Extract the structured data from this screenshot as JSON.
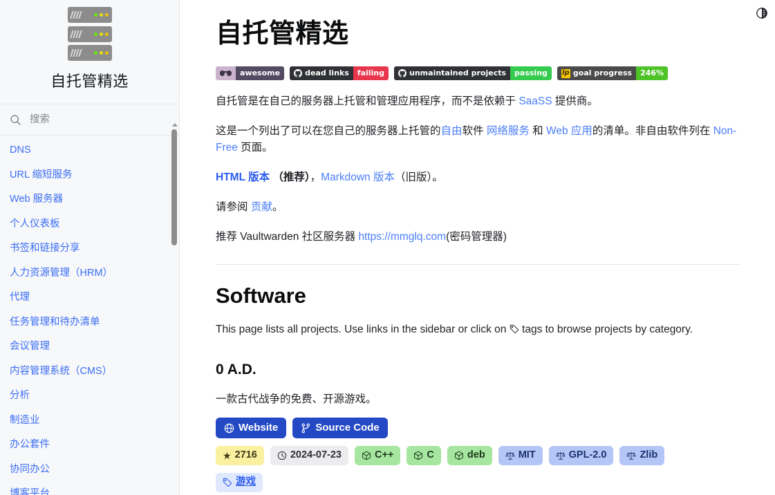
{
  "sidebar": {
    "logo_name": "server-stack-logo",
    "title": "自托管精选",
    "search": {
      "placeholder": "搜索",
      "value": ""
    },
    "items": [
      {
        "label": "DNS"
      },
      {
        "label": "URL 缩短服务"
      },
      {
        "label": "Web 服务器"
      },
      {
        "label": "个人仪表板"
      },
      {
        "label": "书签和链接分享"
      },
      {
        "label": "人力资源管理（HRM）"
      },
      {
        "label": "代理"
      },
      {
        "label": "任务管理和待办清单"
      },
      {
        "label": "会议管理"
      },
      {
        "label": "内容管理系统（CMS）"
      },
      {
        "label": "分析"
      },
      {
        "label": "制造业"
      },
      {
        "label": "办公套件"
      },
      {
        "label": "协同办公"
      },
      {
        "label": "博客平台"
      }
    ]
  },
  "main": {
    "theme_toggle_name": "contrast-icon",
    "page_title": "自托管精选",
    "badges": [
      {
        "name": "awesome-badge",
        "left_icon": "sunglasses-icon",
        "left_text": "",
        "right_text": "awesome",
        "left_color": "#cbb2cd",
        "right_color": "#534b62"
      },
      {
        "name": "dead-links-badge",
        "left_icon": "github-icon",
        "left_text": "dead links",
        "right_text": "failing",
        "left_color": "#2f3136",
        "right_color": "#e8374c"
      },
      {
        "name": "unmaintained-projects-badge",
        "left_icon": "github-icon",
        "left_text": "unmaintained projects",
        "right_text": "passing",
        "left_color": "#2f3136",
        "right_color": "#35cb4e"
      },
      {
        "name": "goal-progress-badge",
        "left_icon": "liberapay-icon",
        "left_text": "goal progress",
        "right_text": "246%",
        "left_color": "#4a4a4a",
        "right_color": "#4ec328"
      }
    ],
    "para1": {
      "t1": "自托管是在自己的服务器上托管和管理应用程序，而不是依赖于 ",
      "link1": "SaaSS",
      "t2": " 提供商。"
    },
    "para2": {
      "t1": "这是一个列出了可以在您自己的服务器上托管的",
      "link1": "自由",
      "t2": "软件 ",
      "link2": "网络服务",
      "t3": " 和 ",
      "link3": "Web 应用",
      "t4": "的清单。非自由软件列在 ",
      "link4": "Non-Free",
      "t5": " 页面。"
    },
    "para3": {
      "link1": "HTML 版本",
      "t1": " ",
      "bold1": "（推荐）",
      "t2": "，",
      "link2": "Markdown 版本",
      "t3": "（旧版）。"
    },
    "para4": {
      "t1": "请参阅 ",
      "link1": "贡献",
      "t2": "。"
    },
    "para5": {
      "t1": "推荐 Vaultwarden 社区服务器 ",
      "link1": "https://mmglq.com",
      "t2": "(密码管理器)"
    },
    "section_title": "Software",
    "section_desc_before": "This page lists all projects. Use links in the sidebar or click on ",
    "section_desc_after": " tags to browse projects by category.",
    "project": {
      "name": "0 A.D.",
      "description": "一款古代战争的免费、开源游戏。",
      "buttons": [
        {
          "name": "website-button",
          "icon": "globe-icon",
          "label": "Website"
        },
        {
          "name": "source-code-button",
          "icon": "git-branch-icon",
          "label": "Source Code"
        }
      ],
      "meta": [
        {
          "name": "stars-chip",
          "icon": "star-icon",
          "label": "2716",
          "kind": "star"
        },
        {
          "name": "updated-chip",
          "icon": "clock-icon",
          "label": "2024-07-23",
          "kind": "date"
        },
        {
          "name": "language-chip",
          "icon": "package-icon",
          "label": "C++",
          "kind": "lang"
        },
        {
          "name": "language-chip",
          "icon": "package-icon",
          "label": "C",
          "kind": "lang"
        },
        {
          "name": "platform-chip",
          "icon": "package-icon",
          "label": "deb",
          "kind": "lang"
        },
        {
          "name": "license-chip",
          "icon": "scale-icon",
          "label": "MIT",
          "kind": "lic"
        },
        {
          "name": "license-chip",
          "icon": "scale-icon",
          "label": "GPL-2.0",
          "kind": "lic"
        },
        {
          "name": "license-chip",
          "icon": "scale-icon",
          "label": "Zlib",
          "kind": "lic"
        }
      ],
      "tags": [
        {
          "name": "tag-chip",
          "icon": "tag-icon",
          "label": "游戏"
        }
      ]
    }
  },
  "colors": {
    "link": "#4a7dfa",
    "sidebar_link": "#3b6ef3",
    "button": "#2449c4",
    "tag": "#2a5bef"
  }
}
